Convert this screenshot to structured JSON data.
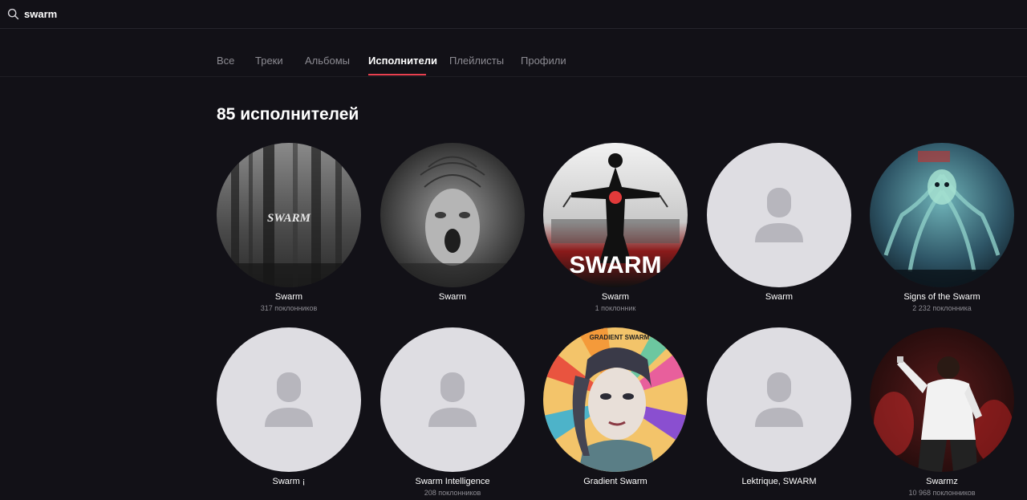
{
  "search": {
    "value": "swarm"
  },
  "tabs": [
    {
      "label": "Все"
    },
    {
      "label": "Треки"
    },
    {
      "label": "Альбомы"
    },
    {
      "label": "Исполнители"
    },
    {
      "label": "Плейлисты"
    },
    {
      "label": "Профили"
    }
  ],
  "active_tab": "Исполнители",
  "results": {
    "title": "85 исполнителей"
  },
  "artists": [
    {
      "name": "Swarm",
      "fans": "317 поклонников",
      "avatar": "dark-forest-logo"
    },
    {
      "name": "Swarm",
      "fans": "",
      "avatar": "screaming-face"
    },
    {
      "name": "Swarm",
      "fans": "1 поклонник",
      "avatar": "chained-figure-logo"
    },
    {
      "name": "Swarm",
      "fans": "",
      "avatar": "placeholder-person-icon"
    },
    {
      "name": "Signs of the Swarm",
      "fans": "2 232 поклонника",
      "avatar": "tentacle-monster-art"
    },
    {
      "name": "Swarm ¡",
      "fans": "",
      "avatar": "placeholder-person-icon"
    },
    {
      "name": "Swarm Intelligence",
      "fans": "208 поклонников",
      "avatar": "placeholder-person-icon"
    },
    {
      "name": "Gradient Swarm",
      "fans": "",
      "avatar": "portrait-illustration"
    },
    {
      "name": "Lektrique, SWARM",
      "fans": "",
      "avatar": "placeholder-person-icon"
    },
    {
      "name": "Swarmz",
      "fans": "10 968 поклонников",
      "avatar": "performer-photo"
    }
  ],
  "avatar_texts": {
    "logo1": "SWARM",
    "logo2": "SWARM",
    "gradient": "GRADIENT SWARM"
  },
  "colors": {
    "background": "#121117",
    "accent": "#e8404f",
    "muted_text": "#8d8c93",
    "placeholder_bg": "#dedde2",
    "placeholder_icon": "#b7b6bd"
  }
}
